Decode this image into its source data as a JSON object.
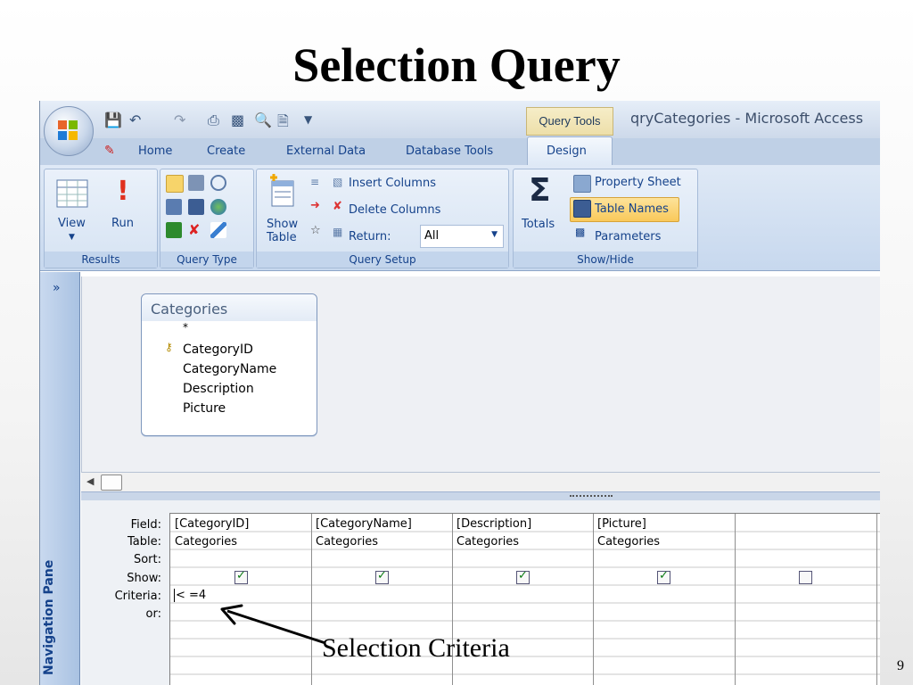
{
  "slide": {
    "title": "Selection Query",
    "page_number": "9",
    "callout": "Selection Criteria"
  },
  "window": {
    "context_tab": "Query Tools",
    "title": "qryCategories - Microsoft Access"
  },
  "tabs": [
    "Home",
    "Create",
    "External Data",
    "Database Tools",
    "Design"
  ],
  "ribbon": {
    "results": {
      "label": "Results",
      "view": "View",
      "run": "Run"
    },
    "query_type": {
      "label": "Query Type"
    },
    "query_setup": {
      "label": "Query Setup",
      "show_table": "Show\nTable",
      "insert_columns": "Insert Columns",
      "delete_columns": "Delete Columns",
      "return_label": "Return:",
      "return_value": "All"
    },
    "show_hide": {
      "label": "Show/Hide",
      "totals": "Totals",
      "property_sheet": "Property Sheet",
      "table_names": "Table Names",
      "parameters": "Parameters"
    }
  },
  "navigation_pane": {
    "label": "Navigation Pane",
    "toggle": "»"
  },
  "table_box": {
    "title": "Categories",
    "fields": [
      "*",
      "CategoryID",
      "CategoryName",
      "Description",
      "Picture"
    ]
  },
  "grid": {
    "row_labels": [
      "Field:",
      "Table:",
      "Sort:",
      "Show:",
      "Criteria:",
      "or:"
    ],
    "columns": [
      {
        "field": "[CategoryID]",
        "table": "Categories",
        "show": true,
        "criteria": "< =4"
      },
      {
        "field": "[CategoryName]",
        "table": "Categories",
        "show": true,
        "criteria": ""
      },
      {
        "field": "[Description]",
        "table": "Categories",
        "show": true,
        "criteria": ""
      },
      {
        "field": "[Picture]",
        "table": "Categories",
        "show": true,
        "criteria": ""
      },
      {
        "field": "",
        "table": "",
        "show": false,
        "criteria": ""
      }
    ]
  },
  "icons": {
    "office": "office-button-icon",
    "save": "save-icon",
    "undo": "undo-icon",
    "redo": "redo-icon",
    "print": "print-icon",
    "sum": "sigma-icon",
    "key": "key-icon"
  }
}
